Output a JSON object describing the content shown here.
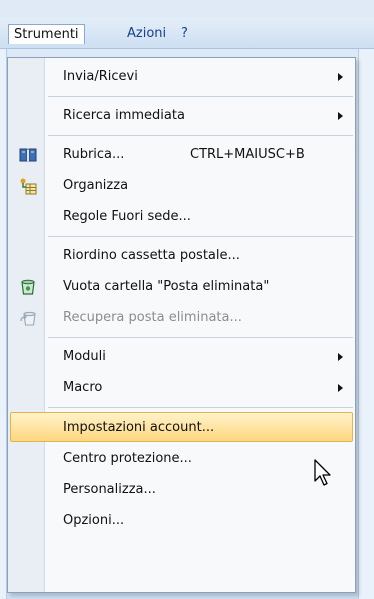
{
  "menubar": {
    "items": [
      {
        "label": "Strumenti",
        "active": true
      },
      {
        "label": "Azioni",
        "active": false
      },
      {
        "label": "?",
        "active": false
      }
    ]
  },
  "menu": {
    "items": [
      {
        "label": "Invia/Ricevi",
        "has_submenu": true
      },
      {
        "label": "Ricerca immediata",
        "has_submenu": true
      },
      {
        "label": "Rubrica...",
        "shortcut": "CTRL+MAIUSC+B",
        "icon": "address-book-icon"
      },
      {
        "label": "Organizza",
        "icon": "organize-icon"
      },
      {
        "label": "Regole Fuori sede..."
      },
      {
        "label": "Riordino cassetta postale..."
      },
      {
        "label": "Vuota cartella \"Posta eliminata\"",
        "icon": "empty-trash-icon"
      },
      {
        "label": "Recupera posta eliminata...",
        "icon": "recover-deleted-icon",
        "disabled": true
      },
      {
        "label": "Moduli",
        "has_submenu": true
      },
      {
        "label": "Macro",
        "has_submenu": true
      },
      {
        "label": "Impostazioni account...",
        "highlighted": true
      },
      {
        "label": "Centro protezione..."
      },
      {
        "label": "Personalizza..."
      },
      {
        "label": "Opzioni..."
      }
    ]
  },
  "colors": {
    "highlight_top": "#fff3c9",
    "highlight_bottom": "#ffd77f",
    "menubar_text": "#15428b"
  }
}
